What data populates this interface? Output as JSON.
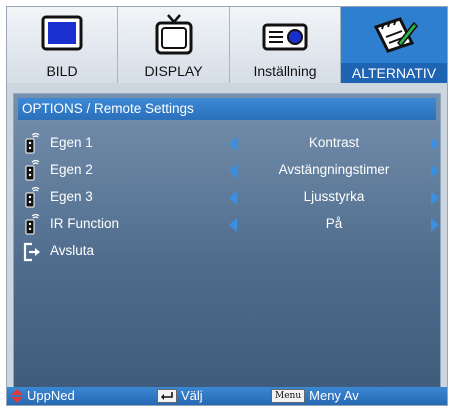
{
  "tabs": [
    {
      "label": "BILD",
      "icon": "monitor-icon"
    },
    {
      "label": "DISPLAY",
      "icon": "tv-icon"
    },
    {
      "label": "Inställning",
      "icon": "projector-icon"
    },
    {
      "label": "ALTERNATIV",
      "icon": "notepad-pen-icon"
    }
  ],
  "panel": {
    "title": "OPTIONS / Remote Settings",
    "rows": [
      {
        "label": "Egen 1",
        "value": "Kontrast"
      },
      {
        "label": "Egen 2",
        "value": "Avstängningstimer"
      },
      {
        "label": "Egen 3",
        "value": "Ljusstyrka"
      },
      {
        "label": "IR Function",
        "value": "På"
      }
    ],
    "exit_label": "Avsluta"
  },
  "status": {
    "updown": "UppNed",
    "select": "Välj",
    "menu_key": "Menu",
    "menu_off": "Meny Av"
  },
  "colors": {
    "accent": "#2f7fd0",
    "panel": "#4e6b8c",
    "arrow": "#3b8fe0"
  }
}
